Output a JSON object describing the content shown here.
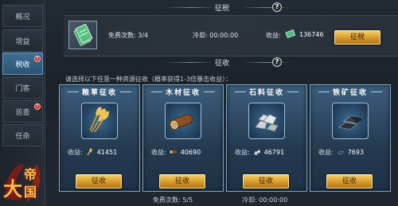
{
  "sidebar": {
    "items": [
      {
        "label": "概况"
      },
      {
        "label": "增益"
      },
      {
        "label": "税收",
        "active": true,
        "badge": "!"
      },
      {
        "label": "门客"
      },
      {
        "label": "巡查",
        "badge": "!"
      },
      {
        "label": "任命"
      }
    ],
    "logo_text": [
      "大",
      "帝",
      "国"
    ]
  },
  "tax": {
    "title": "征税",
    "free_count_label": "免费次数: 3/4",
    "cooldown_label": "冷却: 00:00:00",
    "income_label": "收益:",
    "income_value": "136746",
    "button_label": "征税"
  },
  "levy": {
    "title": "征收",
    "subtitle": "请选择以下任意一种资源征收（概率获得1-3倍暴击收益）：",
    "cards": [
      {
        "title": "粮草征收",
        "income_label": "收益:",
        "income_value": "41451",
        "button_label": "征收",
        "resource_icon": "wheat-icon"
      },
      {
        "title": "木材征收",
        "income_label": "收益:",
        "income_value": "40690",
        "button_label": "征收",
        "resource_icon": "wood-log-icon"
      },
      {
        "title": "石料征收",
        "income_label": "收益:",
        "income_value": "46791",
        "button_label": "征收",
        "resource_icon": "stone-icon"
      },
      {
        "title": "铁矿征收",
        "income_label": "收益:",
        "income_value": "7693",
        "button_label": "征收",
        "resource_icon": "iron-ingot-icon"
      }
    ],
    "free_count_label": "免费次数: 5/5",
    "cooldown_label": "冷却: 00:00:00"
  },
  "colors": {
    "accent_gold": "#e8b54a",
    "active_tab": "#3d6f93",
    "badge_red": "#d9262a"
  }
}
